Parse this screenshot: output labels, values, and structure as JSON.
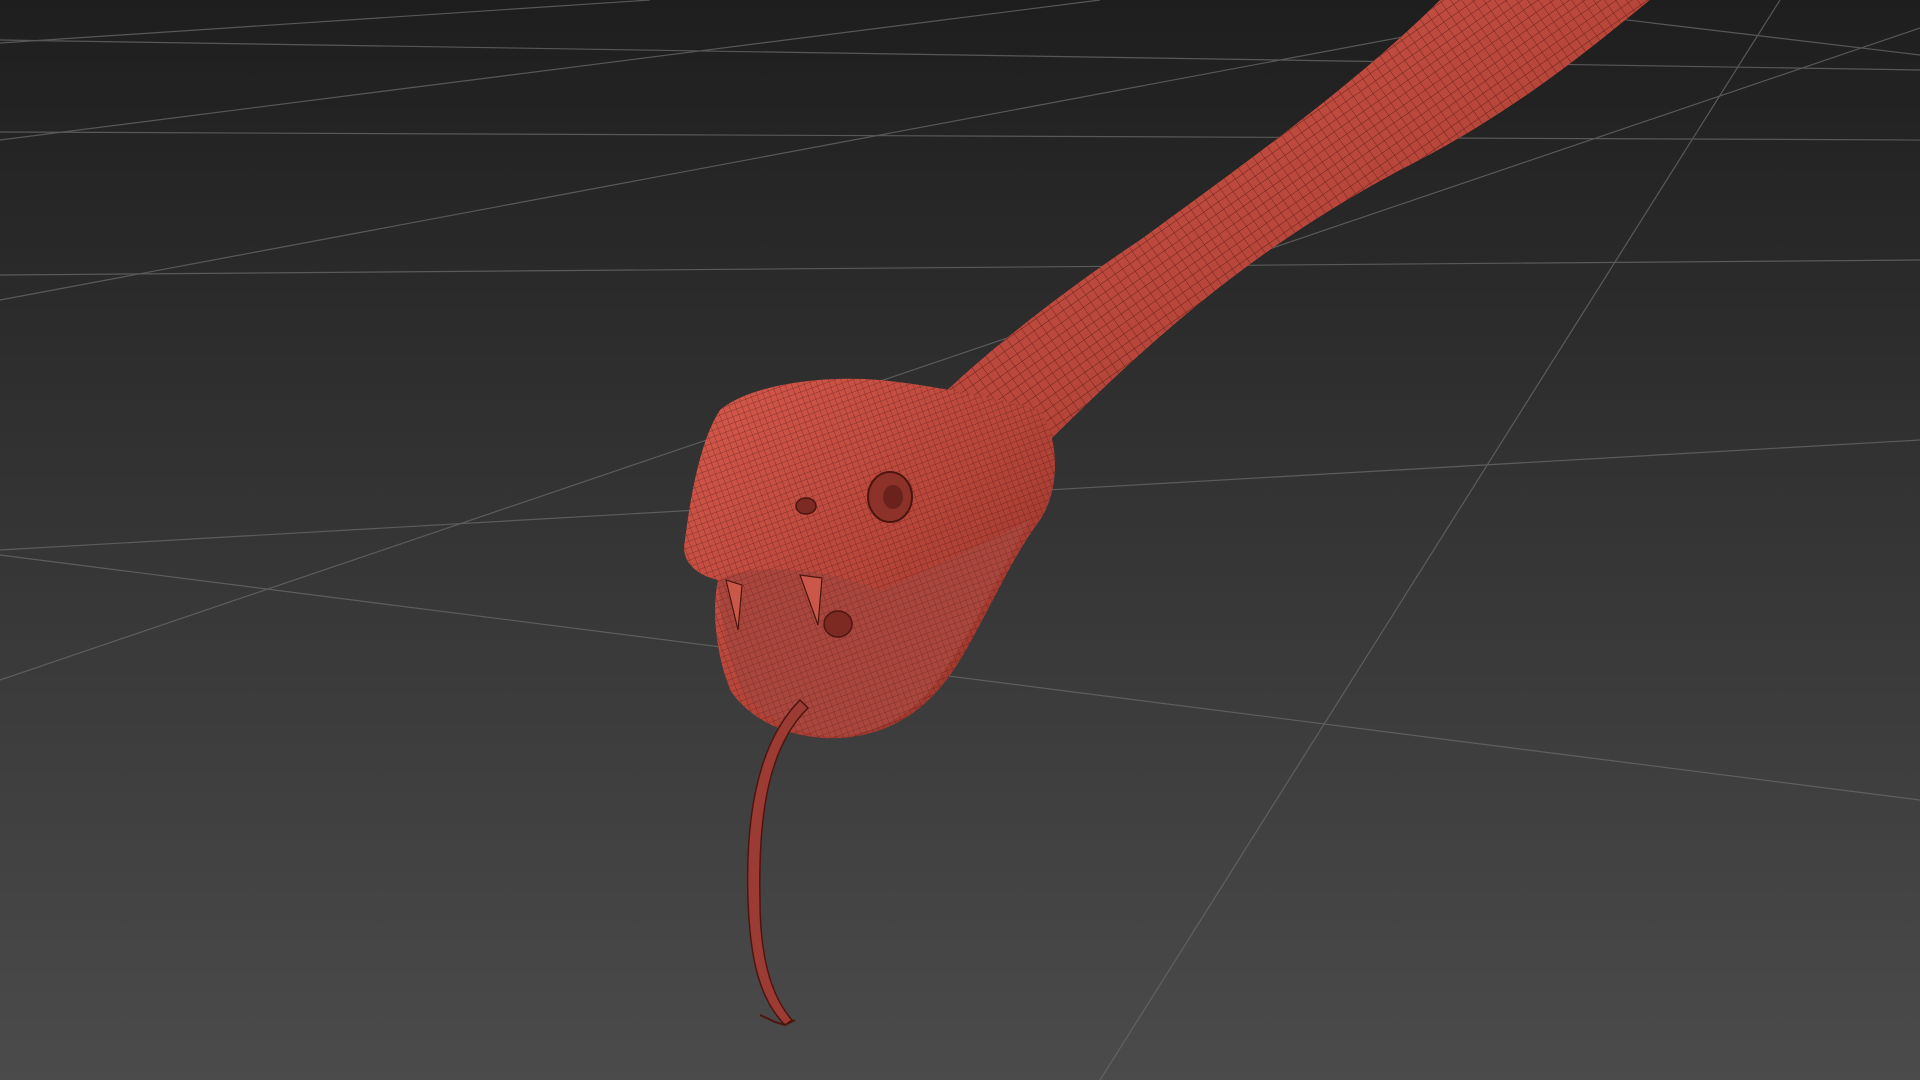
{
  "viewport": {
    "mode": "perspective",
    "background_top": "#1f1f1f",
    "background_bottom": "#4a4a4a",
    "grid_color": "#6b6b6b",
    "grid_visible": true
  },
  "model": {
    "subject": "snake",
    "display": "wireframe-on-shaded",
    "surface_color": "#b8483e",
    "wire_color": "#5a1a14"
  }
}
